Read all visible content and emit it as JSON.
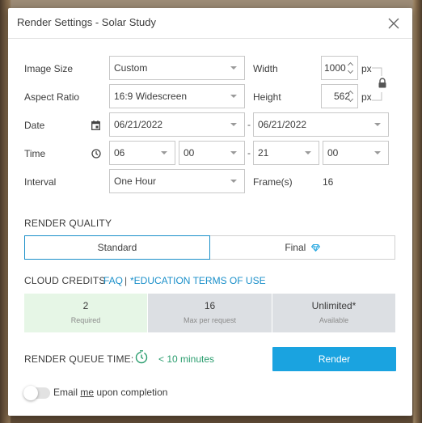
{
  "dialog": {
    "title": "Render Settings - Solar Study",
    "close_icon": "close-icon"
  },
  "settings": {
    "image_size_label": "Image Size",
    "image_size_value": "Custom",
    "aspect_ratio_label": "Aspect Ratio",
    "aspect_ratio_value": "16:9 Widescreen",
    "width_label": "Width",
    "width_value": "1000",
    "height_label": "Height",
    "height_value": "562",
    "unit": "px",
    "date_label": "Date",
    "date_start": "06/21/2022",
    "date_end": "06/21/2022",
    "time_label": "Time",
    "time_start_hour": "06",
    "time_start_minute": "00",
    "time_end_hour": "21",
    "time_end_minute": "00",
    "range_separator": "-",
    "interval_label": "Interval",
    "interval_value": "One Hour",
    "frames_label": "Frame(s)",
    "frames_value": "16",
    "icons": {
      "date": "calendar-icon",
      "time": "clock-icon",
      "lock": "lock-icon"
    }
  },
  "render_quality": {
    "heading": "RENDER QUALITY",
    "options": [
      "Standard",
      "Final"
    ],
    "selected": "Standard",
    "final_icon": "diamond-icon"
  },
  "cloud_credits": {
    "heading": "CLOUD CREDITS",
    "faq_link": "FAQ",
    "separator": "|",
    "terms_link": "*EDUCATION TERMS OF USE",
    "cards": [
      {
        "value": "2",
        "sublabel": "Required",
        "color": "#e6f6e6"
      },
      {
        "value": "16",
        "sublabel": "Max per request",
        "color": "#dcdfe3"
      },
      {
        "value": "Unlimited*",
        "sublabel": "Available",
        "color": "#dcdfe3"
      }
    ]
  },
  "queue": {
    "label": "RENDER QUEUE TIME:",
    "value": "< 10 minutes",
    "icon": "timer-icon",
    "color": "#2a9d6e"
  },
  "actions": {
    "render_label": "Render",
    "accent": "#1aa3e0"
  },
  "email": {
    "pre": "Email ",
    "mid": "me",
    "post": " upon completion",
    "enabled": false
  }
}
